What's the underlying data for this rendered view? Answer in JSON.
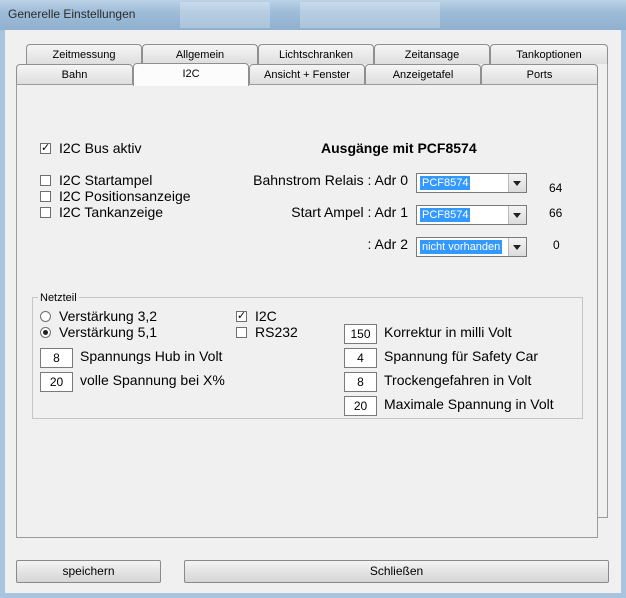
{
  "window": {
    "title": "Generelle Einstellungen"
  },
  "tabs_row1": [
    "Zeitmessung",
    "Allgemein",
    "Lichtschranken",
    "Zeitansage",
    "Tankoptionen"
  ],
  "tabs_row2": [
    "Bahn",
    "I2C",
    "Ansicht + Fenster",
    "Anzeigetafel",
    "Ports"
  ],
  "active_tab": "I2C",
  "i2c": {
    "bus_aktiv": {
      "label": "I2C Bus aktiv",
      "checked": true
    },
    "startampel": {
      "label": "I2C Startampel",
      "checked": false
    },
    "positionsanzeige": {
      "label": "I2C Positionsanzeige",
      "checked": false
    },
    "tankanzeige": {
      "label": "I2C Tankanzeige",
      "checked": false
    }
  },
  "ausgaenge": {
    "heading": "Ausgänge mit PCF8574",
    "rows": [
      {
        "label": "Bahnstrom Relais : Adr 0",
        "value": "PCF8574",
        "number": "64"
      },
      {
        "label": "Start Ampel : Adr 1",
        "value": "PCF8574",
        "number": "66"
      },
      {
        "label": ": Adr 2",
        "value": "nicht vorhanden",
        "number": "0"
      }
    ]
  },
  "netzteil": {
    "legend": "Netzteil",
    "verstaerkung_32": {
      "label": "Verstärkung 3,2",
      "selected": false
    },
    "verstaerkung_51": {
      "label": "Verstärkung 5,1",
      "selected": true
    },
    "i2c": {
      "label": "I2C",
      "checked": true
    },
    "rs232": {
      "label": "RS232",
      "checked": false
    },
    "spannungs_hub": {
      "value": "8",
      "label": "Spannungs Hub in Volt"
    },
    "volle_spannung": {
      "value": "20",
      "label": "volle Spannung bei X%"
    },
    "korrektur": {
      "value": "150",
      "label": "Korrektur in milli Volt"
    },
    "safety_car": {
      "value": "4",
      "label": "Spannung für Safety Car"
    },
    "trockengefahren": {
      "value": "8",
      "label": "Trockengefahren in Volt"
    },
    "maximale": {
      "value": "20",
      "label": "Maximale Spannung in Volt"
    }
  },
  "buttons": {
    "speichern": "speichern",
    "schliessen": "Schließen"
  },
  "icons": {
    "check": "check-icon",
    "dropdown": "chevron-down-icon"
  }
}
